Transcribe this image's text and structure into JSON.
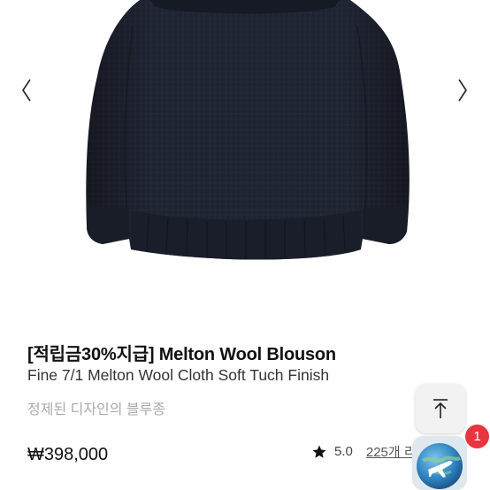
{
  "carousel": {
    "prev_glyph": "〈",
    "next_glyph": "〉",
    "icons": {
      "prev": "chevron-left-icon",
      "next": "chevron-right-icon"
    }
  },
  "product": {
    "title": "[적립금30%지급] Melton Wool Blouson",
    "subtitle": "Fine 7/1 Melton Wool Cloth Soft Tuch Finish",
    "description": "정제된 디자인의 블루종",
    "price": "₩398,000",
    "rating": "5.0",
    "reviews": "225개 리뷰보기"
  },
  "floating": {
    "scroll_top_icon": "arrow-up-to-top-icon",
    "badge_count": "1",
    "app_icon": "airplane-globe-icon"
  },
  "colors": {
    "jacket": "#1e2230",
    "badge": "#e8353f",
    "text_muted": "#aaaaaa"
  }
}
